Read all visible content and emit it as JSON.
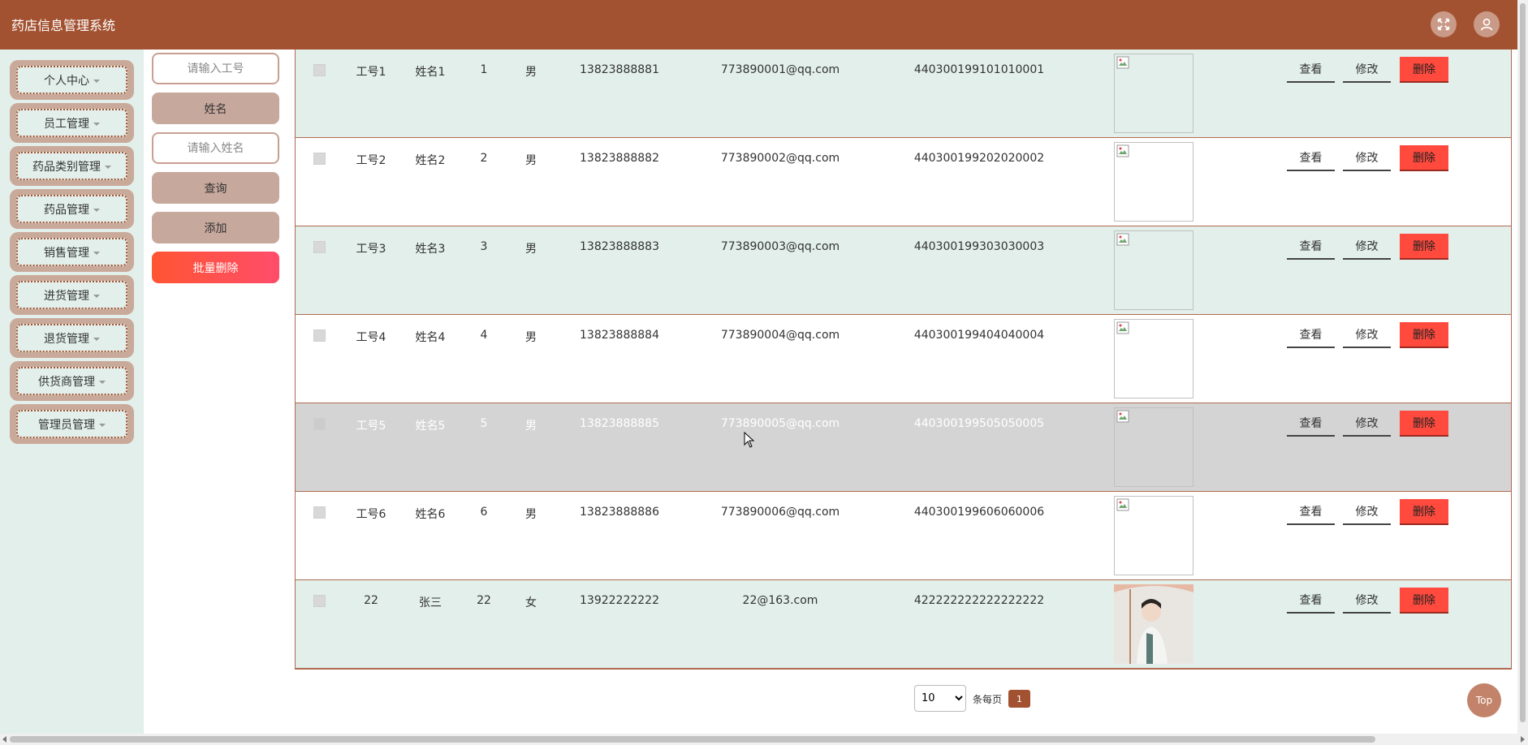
{
  "app": {
    "title": "药店信息管理系统"
  },
  "header": {
    "fullscreen_icon": "expand-arrows-icon",
    "avatar_icon": "user-icon"
  },
  "sidebar": {
    "items": [
      {
        "label": "个人中心"
      },
      {
        "label": "员工管理"
      },
      {
        "label": "药品类别管理"
      },
      {
        "label": "药品管理"
      },
      {
        "label": "销售管理"
      },
      {
        "label": "进货管理"
      },
      {
        "label": "退货管理"
      },
      {
        "label": "供货商管理"
      },
      {
        "label": "管理员管理"
      }
    ]
  },
  "search": {
    "employee_no_placeholder": "请输入工号",
    "name_label": "姓名",
    "name_placeholder": "请输入姓名",
    "query_label": "查询",
    "add_label": "添加",
    "batch_delete_label": "批量删除"
  },
  "table": {
    "actions": {
      "view": "查看",
      "edit": "修改",
      "delete": "删除"
    },
    "rows": [
      {
        "no": "工号1",
        "name": "姓名1",
        "age": "1",
        "gender": "男",
        "phone": "13823888881",
        "email": "773890001@qq.com",
        "id_card": "440300199101010001",
        "photo": "broken"
      },
      {
        "no": "工号2",
        "name": "姓名2",
        "age": "2",
        "gender": "男",
        "phone": "13823888882",
        "email": "773890002@qq.com",
        "id_card": "440300199202020002",
        "photo": "broken"
      },
      {
        "no": "工号3",
        "name": "姓名3",
        "age": "3",
        "gender": "男",
        "phone": "13823888883",
        "email": "773890003@qq.com",
        "id_card": "440300199303030003",
        "photo": "broken"
      },
      {
        "no": "工号4",
        "name": "姓名4",
        "age": "4",
        "gender": "男",
        "phone": "13823888884",
        "email": "773890004@qq.com",
        "id_card": "440300199404040004",
        "photo": "broken"
      },
      {
        "no": "工号5",
        "name": "姓名5",
        "age": "5",
        "gender": "男",
        "phone": "13823888885",
        "email": "773890005@qq.com",
        "id_card": "440300199505050005",
        "photo": "broken"
      },
      {
        "no": "工号6",
        "name": "姓名6",
        "age": "6",
        "gender": "男",
        "phone": "13823888886",
        "email": "773890006@qq.com",
        "id_card": "440300199606060006",
        "photo": "broken"
      },
      {
        "no": "22",
        "name": "张三",
        "age": "22",
        "gender": "女",
        "phone": "13922222222",
        "email": "22@163.com",
        "id_card": "422222222222222222",
        "photo": "portrait"
      }
    ]
  },
  "pagination": {
    "page_size": "10",
    "page_size_options": [
      "10"
    ],
    "per_page_label": "条每页",
    "current_page": "1"
  },
  "top_button": {
    "label": "Top"
  },
  "colors": {
    "header": "#a35231",
    "sidebar_bg": "#e2efeb",
    "row_alt": "#e2efeb",
    "row_hover": "#d4d4d4",
    "delete": "#ff4a3d"
  }
}
